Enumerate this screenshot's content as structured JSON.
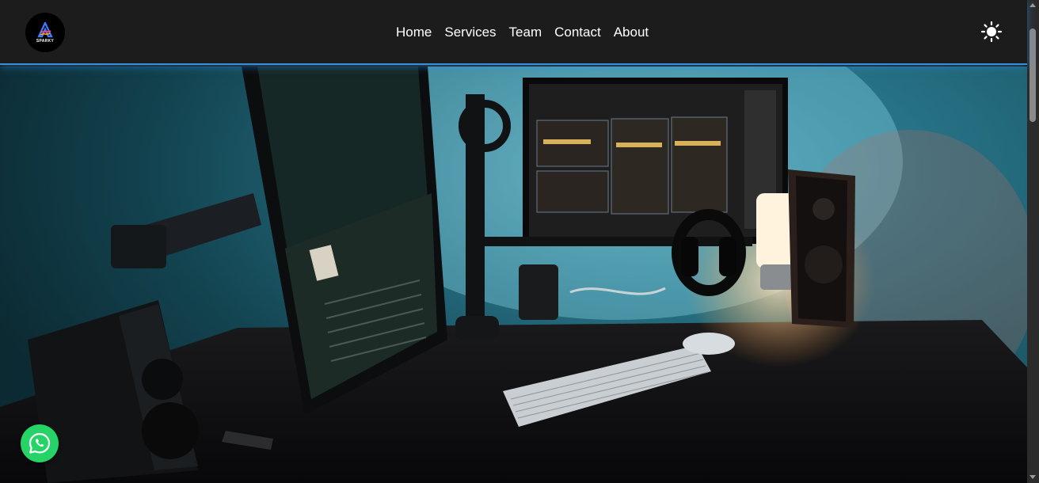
{
  "brand": {
    "logo_text": "SPARKY"
  },
  "nav": {
    "items": [
      {
        "label": "Home"
      },
      {
        "label": "Services"
      },
      {
        "label": "Team"
      },
      {
        "label": "Contact"
      },
      {
        "label": "About"
      }
    ]
  },
  "icons": {
    "theme_toggle": "sun-icon",
    "floating_chat": "whatsapp-icon"
  },
  "colors": {
    "navbar_bg": "#1c1c1c",
    "navbar_border_glow": "#3a8fd6",
    "whatsapp_green": "#25d366"
  },
  "hero": {
    "image_subject": "dark desk setup with two monitors, keyboard, speakers and lamp"
  }
}
